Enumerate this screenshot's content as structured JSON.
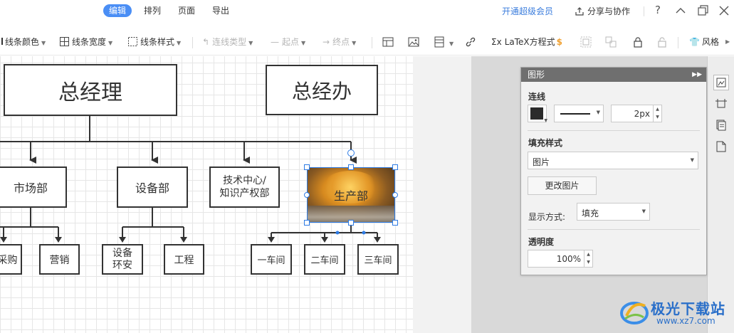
{
  "menu": {
    "edit": "编辑",
    "arrange": "排列",
    "page": "页面",
    "export": "导出"
  },
  "top_right": {
    "vip": "开通超级会员",
    "share": "分享与协作",
    "help": "?"
  },
  "toolbar": {
    "line_color": "线条颜色",
    "line_width": "线条宽度",
    "line_style": "线条样式",
    "connector_type": "连线类型",
    "start_point": "起点",
    "end_point": "终点",
    "latex": "LaTeX方程式",
    "style": "风格"
  },
  "diagram": {
    "gm": "总经理",
    "gmo": "总经办",
    "market": "市场部",
    "equipment": "设备部",
    "tech_line1": "技术中心/",
    "tech_line2": "知识产权部",
    "production": "生产部",
    "purchase": "采购",
    "sales": "营销",
    "equip_install_line1": "设备",
    "equip_install_line2": "环安",
    "engineering": "工程",
    "workshop1": "一车间",
    "workshop2": "二车间",
    "workshop3": "三车间"
  },
  "panel": {
    "title": "图形",
    "line_section": "连线",
    "line_width_value": "2px",
    "fill_section": "填充样式",
    "fill_type": "图片",
    "change_image": "更改图片",
    "display_mode_label": "显示方式:",
    "display_mode_value": "填充",
    "opacity_section": "透明度",
    "opacity_value": "100%"
  },
  "watermark": {
    "name": "极光下载站",
    "url": "www.xz7.com"
  },
  "colors": {
    "accent": "#4a8ef5",
    "vip": "#3b7ddd",
    "panel_title_bg": "#6f6f6f"
  }
}
